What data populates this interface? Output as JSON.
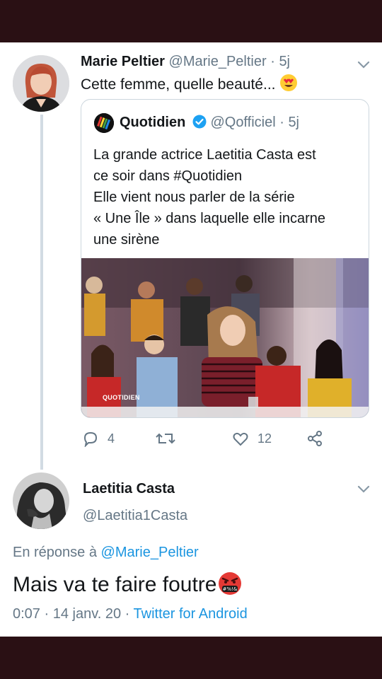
{
  "tweet1": {
    "name": "Marie Peltier",
    "handle": "@Marie_Peltier",
    "time": "5j",
    "text": "Cette femme, quelle beauté...",
    "emoji": "heart-eyes-emoji"
  },
  "quoted": {
    "name": "Quotidien",
    "handle": "@Qofficiel",
    "time": "5j",
    "lines": [
      "La grande actrice Laetitia Casta est",
      "ce soir dans #Quotidien",
      "Elle vient nous parler de la série",
      "« Une Île » dans laquelle elle incarne",
      "une sirène"
    ],
    "image_watermark": "QUOTIDIEN"
  },
  "actions": {
    "replies": "4",
    "retweets": "",
    "likes": "12"
  },
  "tweet2": {
    "name": "Laetitia Casta",
    "handle": "@Laetitia1Casta",
    "reply_prefix": "En réponse à",
    "reply_handle": "@Marie_Peltier",
    "text": "Mais va te faire foutre",
    "emoji": "cursing-face-emoji",
    "time": "0:07",
    "date": "14 janv. 20",
    "client": "Twitter for Android"
  },
  "separator": "·",
  "colors": {
    "link": "#1b95e0",
    "muted": "#657786",
    "verified": "#1da1f2",
    "frame": "#2a1014"
  }
}
